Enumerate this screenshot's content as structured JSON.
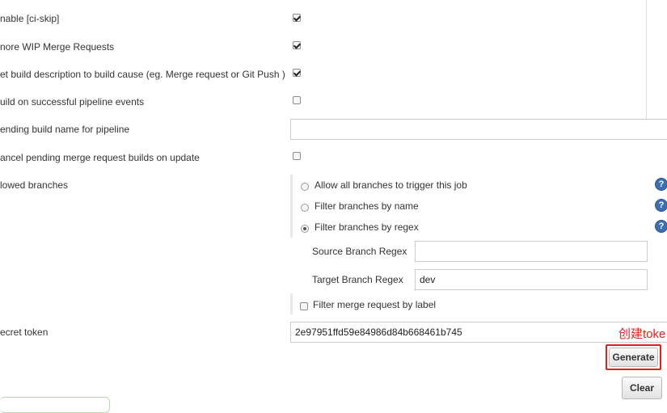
{
  "fields": {
    "ci_skip_label": "nable [ci-skip]",
    "ignore_wip_label": "nore WIP Merge Requests",
    "set_build_desc_label": "et build description to build cause (eg. Merge request or Git Push )",
    "pipeline_events_label": "uild on successful pipeline events",
    "pending_build_name_label": "ending build name for pipeline",
    "pending_build_name_value": "",
    "cancel_pending_label": "ancel pending merge request builds on update",
    "allowed_branches_label": "lowed branches",
    "secret_token_label": "ecret token",
    "secret_token_value": "2e97951ffd59e84986d84b668461b745"
  },
  "checkboxes": {
    "ci_skip": true,
    "ignore_wip": true,
    "set_build_desc": true,
    "pipeline_events": false,
    "cancel_pending": false,
    "filter_by_label": false
  },
  "branches": {
    "options": [
      "Allow all branches to trigger this job",
      "Filter branches by name",
      "Filter branches by regex"
    ],
    "selected": "Filter branches by regex",
    "source_regex_label": "Source Branch Regex",
    "source_regex_value": "",
    "target_regex_label": "Target Branch Regex",
    "target_regex_value": "dev",
    "filter_label_text": "Filter merge request by label"
  },
  "buttons": {
    "generate": "Generate",
    "clear": "Clear"
  },
  "annotation": {
    "text": "创建toke"
  },
  "colors": {
    "annotation_red": "#e02020",
    "help_blue": "#3b6fb0"
  }
}
